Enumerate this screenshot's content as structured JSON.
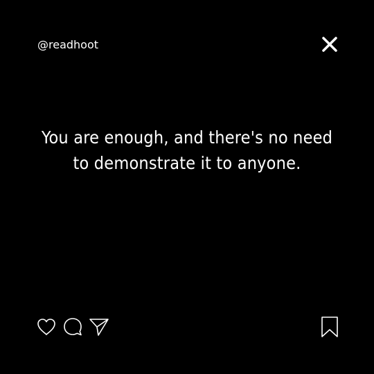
{
  "post": {
    "handle": "@readhoot",
    "quote_line1": "You are enough, and there's no need",
    "quote_line2": "to demonstrate it to anyone.",
    "background_color": "#000000",
    "text_color": "#ffffff"
  },
  "icons": {
    "close": "close-icon",
    "like": "heart-icon",
    "comment": "comment-bubble-icon",
    "share": "send-paper-plane-icon",
    "save": "bookmark-icon"
  }
}
